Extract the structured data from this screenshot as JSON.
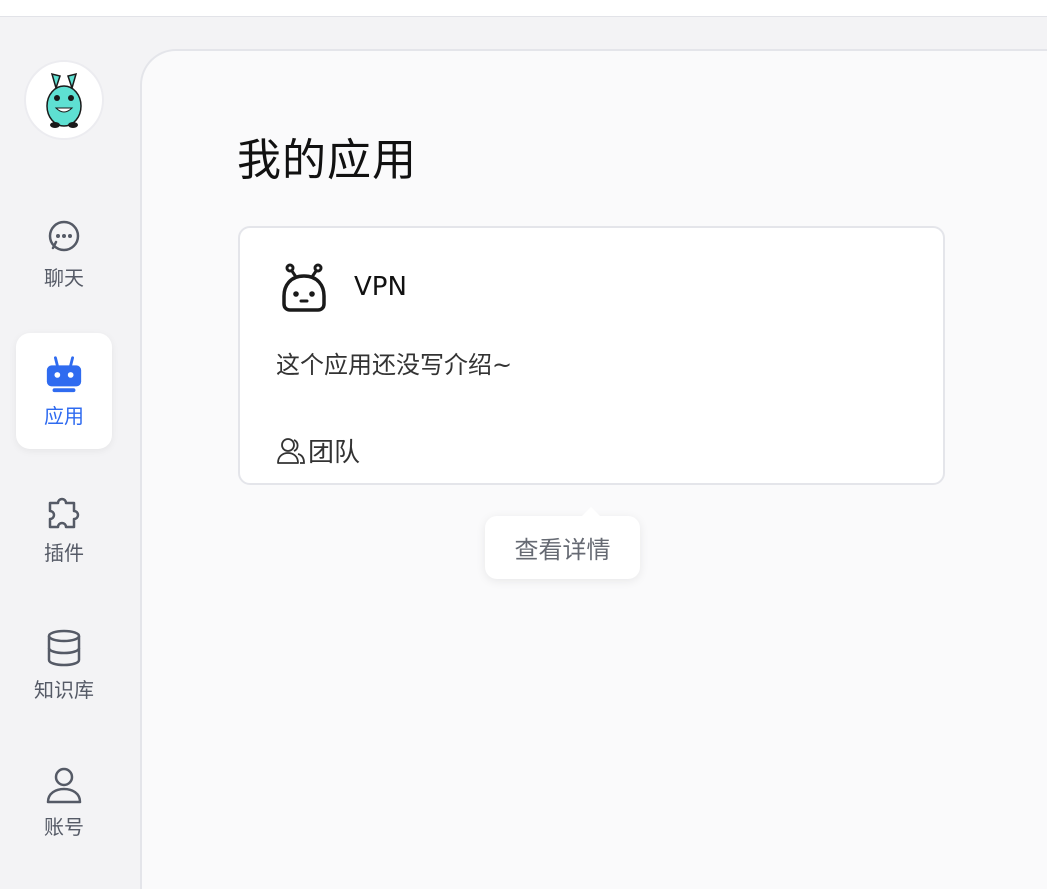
{
  "sidebar": {
    "avatar_icon": "bunny-mascot-icon",
    "items": [
      {
        "label": "聊天",
        "icon": "chat-bubble-icon",
        "active": false
      },
      {
        "label": "应用",
        "icon": "robot-icon",
        "active": true
      },
      {
        "label": "插件",
        "icon": "puzzle-icon",
        "active": false
      },
      {
        "label": "知识库",
        "icon": "database-icon",
        "active": false
      },
      {
        "label": "账号",
        "icon": "user-icon",
        "active": false
      }
    ]
  },
  "main": {
    "title": "我的应用",
    "apps": [
      {
        "name": "VPN",
        "icon": "robot-face-icon",
        "description": "这个应用还没写介绍~",
        "team_label": "团队"
      }
    ],
    "tooltip": "查看详情"
  },
  "colors": {
    "accent": "#2f6bf0",
    "sidebar_bg": "#f3f3f5",
    "content_bg": "#fafafb",
    "nav_text": "#555a66"
  }
}
